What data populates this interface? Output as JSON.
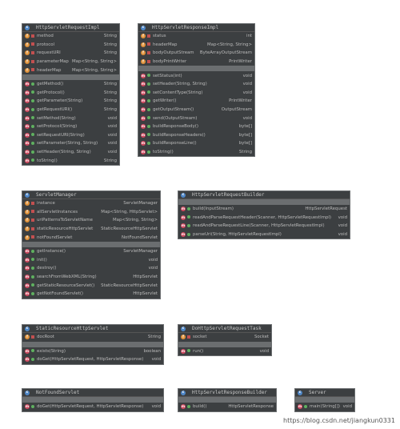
{
  "colors": {
    "background": "#ffffff",
    "class_bg": "#3c3f41",
    "field_icon": "#e0923a",
    "method_icon": "#d0495f",
    "class_icon": "#4f87c7",
    "public": "#5fb05f",
    "private": "#c25050"
  },
  "classes": [
    {
      "id": "req",
      "name": "HttpServletRequestImpl",
      "fields": [
        {
          "name": "method",
          "type": "String"
        },
        {
          "name": "protocol",
          "type": "String"
        },
        {
          "name": "requestURI",
          "type": "String"
        },
        {
          "name": "parameterMap",
          "type": "Map<String, String>"
        },
        {
          "name": "headerMap",
          "type": "Map<String, String>"
        }
      ],
      "methods": [
        {
          "name": "getMethod()",
          "type": "String"
        },
        {
          "name": "getProtocol()",
          "type": "String"
        },
        {
          "name": "getParameter(String)",
          "type": "String"
        },
        {
          "name": "getRequestURI()",
          "type": "String"
        },
        {
          "name": "setMethod(String)",
          "type": "void"
        },
        {
          "name": "setProtocol(String)",
          "type": "void"
        },
        {
          "name": "setRequestURI(String)",
          "type": "void"
        },
        {
          "name": "setParameter(String, String)",
          "type": "void"
        },
        {
          "name": "setHeader(String, String)",
          "type": "void"
        },
        {
          "name": "toString()",
          "type": "String"
        }
      ]
    },
    {
      "id": "resp",
      "name": "HttpServletResponseImpl",
      "fields": [
        {
          "name": "status",
          "type": "int"
        },
        {
          "name": "headerMap",
          "type": "Map<String, String>"
        },
        {
          "name": "bodyOutputStream",
          "type": "ByteArrayOutputStream"
        },
        {
          "name": "bodyPrintWriter",
          "type": "PrintWriter"
        }
      ],
      "methods": [
        {
          "name": "setStatus(int)",
          "type": "void"
        },
        {
          "name": "setHeader(String, String)",
          "type": "void"
        },
        {
          "name": "setContentType(String)",
          "type": "void"
        },
        {
          "name": "getWriter()",
          "type": "PrintWriter"
        },
        {
          "name": "getOutputStream()",
          "type": "OutputStream"
        },
        {
          "name": "send(OutputStream)",
          "type": "void"
        },
        {
          "name": "buildResponseBody()",
          "type": "byte[]"
        },
        {
          "name": "buildResponseHeaders()",
          "type": "byte[]"
        },
        {
          "name": "buildResponseLine()",
          "type": "byte[]"
        },
        {
          "name": "toString()",
          "type": "String"
        }
      ]
    },
    {
      "id": "mgr",
      "name": "ServletManager",
      "fields": [
        {
          "name": "instance",
          "type": "ServletManager"
        },
        {
          "name": "allServletInstances",
          "type": "Map<String, HttpServlet>"
        },
        {
          "name": "uriPatternsToServletName",
          "type": "Map<String, String>"
        },
        {
          "name": "staticResourceHttpServlet",
          "type": "StaticResourceHttpServlet"
        },
        {
          "name": "notFoundServlet",
          "type": "NotFoundServlet"
        }
      ],
      "methods": [
        {
          "name": "getInstance()",
          "type": "ServletManager"
        },
        {
          "name": "init()",
          "type": "void"
        },
        {
          "name": "destroy()",
          "type": "void"
        },
        {
          "name": "searchFromWebXML(String)",
          "type": "HttpServlet"
        },
        {
          "name": "getStaticResourceServlet()",
          "type": "StaticResourceHttpServlet"
        },
        {
          "name": "getNotFoundServlet()",
          "type": "HttpServlet"
        }
      ]
    },
    {
      "id": "reqb",
      "name": "HttpServletRequestBuilder",
      "fields": [],
      "methods": [
        {
          "name": "build(InputStream)",
          "type": "HttpServletRequest"
        },
        {
          "name": "readAndParseRequestHeader(Scanner, HttpServletRequestImpl)",
          "type": "void"
        },
        {
          "name": "readAndParseRequestLine(Scanner, HttpServletRequestImpl)",
          "type": "void"
        },
        {
          "name": "parseUri(String, HttpServletRequestImpl)",
          "type": "void"
        }
      ]
    },
    {
      "id": "static",
      "name": "StaticResourceHttpServlet",
      "fields": [
        {
          "name": "docRoot",
          "type": "String"
        }
      ],
      "methods": [
        {
          "name": "exists(String)",
          "type": "boolean"
        },
        {
          "name": "doGet(HttpServletRequest, HttpServletResponse)",
          "type": "void"
        }
      ]
    },
    {
      "id": "task",
      "name": "DoHttpServletRequestTask",
      "fields": [
        {
          "name": "socket",
          "type": "Socket"
        }
      ],
      "methods": [
        {
          "name": "run()",
          "type": "void"
        }
      ]
    },
    {
      "id": "nf",
      "name": "NotFoundServlet",
      "fields": [],
      "methods": [
        {
          "name": "doGet(HttpServletRequest, HttpServletResponse)",
          "type": "void"
        }
      ]
    },
    {
      "id": "respb",
      "name": "HttpServletResponseBuilder",
      "fields": [],
      "methods": [
        {
          "name": "build()",
          "type": "HttpServletResponse"
        }
      ]
    },
    {
      "id": "srv",
      "name": "Server",
      "fields": [],
      "methods": [
        {
          "name": "main(String[])",
          "type": "void"
        }
      ]
    }
  ],
  "watermark": "https://blog.csdn.net/jiangkun0331"
}
